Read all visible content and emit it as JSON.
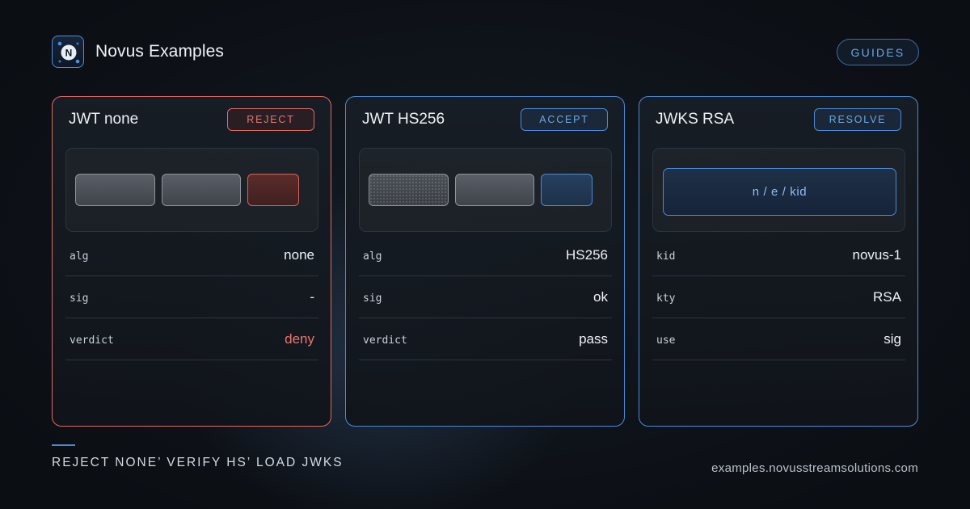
{
  "header": {
    "logo_letter": "N",
    "brand": "Novus Examples",
    "guides_label": "GUIDES"
  },
  "cards": [
    {
      "title": "JWT none",
      "badge": "REJECT",
      "rows": [
        {
          "key": "alg",
          "value": "none"
        },
        {
          "key": "sig",
          "value": "-"
        },
        {
          "key": "verdict",
          "value": "deny"
        }
      ]
    },
    {
      "title": "JWT HS256",
      "badge": "ACCEPT",
      "rows": [
        {
          "key": "alg",
          "value": "HS256"
        },
        {
          "key": "sig",
          "value": "ok"
        },
        {
          "key": "verdict",
          "value": "pass"
        }
      ]
    },
    {
      "title": "JWKS RSA",
      "badge": "RESOLVE",
      "panel_label": "n / e / kid",
      "rows": [
        {
          "key": "kid",
          "value": "novus-1"
        },
        {
          "key": "kty",
          "value": "RSA"
        },
        {
          "key": "use",
          "value": "sig"
        }
      ]
    }
  ],
  "footer": {
    "caption": "REJECT NONE’ VERIFY HS’ LOAD JWKS",
    "url": "examples.novusstreamsolutions.com"
  },
  "colors": {
    "accent_blue": "#4b8ad6",
    "danger_red": "#e06b60",
    "background": "#0b0e13"
  }
}
